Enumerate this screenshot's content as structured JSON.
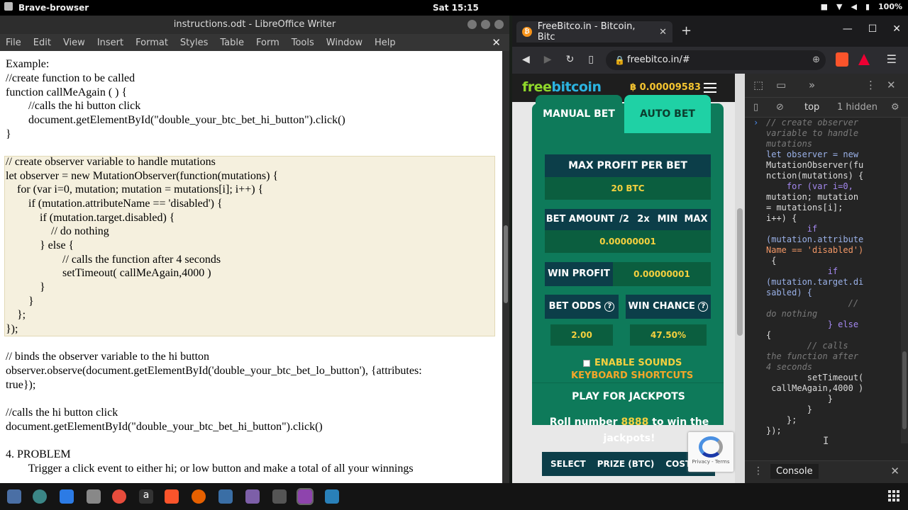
{
  "system_bar": {
    "app_name": "Brave-browser",
    "clock": "Sat 15:15",
    "battery": "100%"
  },
  "libreoffice": {
    "title": "instructions.odt - LibreOffice Writer",
    "menu": [
      "File",
      "Edit",
      "View",
      "Insert",
      "Format",
      "Styles",
      "Table",
      "Form",
      "Tools",
      "Window",
      "Help"
    ],
    "lines": [
      "Example:",
      "//create function to be called",
      "function callMeAgain ( ) {",
      "        //calls the hi button click",
      "        document.getElementById(\"double_your_btc_bet_hi_button\").click()",
      "}",
      "// create observer variable to handle mutations",
      "let observer = new MutationObserver(function(mutations) {",
      "    for (var i=0, mutation; mutation = mutations[i]; i++) {",
      "        if (mutation.attributeName == 'disabled') {",
      "            if (mutation.target.disabled) {",
      "                // do nothing",
      "            } else {",
      "                    // calls the function after 4 seconds",
      "                    setTimeout( callMeAgain,4000 )",
      "            }",
      "        }",
      "    };",
      "});",
      "// binds the observer variable to the hi button",
      "observer.observe(document.getElementById('double_your_btc_bet_lo_button'), {attributes:",
      "true});",
      "//calls the hi button click",
      "document.getElementById(\"double_your_btc_bet_hi_button\").click()",
      "4. PROBLEM",
      "        Trigger a click event to either hi; or low button and make a total of all your winnings"
    ]
  },
  "browser": {
    "tab_title": "FreeBitco.in - Bitcoin, Bitc",
    "url": "freebitco.in/#",
    "site": {
      "logo_part1": "free",
      "logo_part2": "bitcoin",
      "balance": "฿ 0.00009583",
      "tab_manual": "MANUAL BET",
      "tab_auto": "AUTO BET",
      "max_profit_label": "MAX PROFIT PER BET",
      "max_profit_value": "20 BTC",
      "bet_amount_label": "BET AMOUNT",
      "bet_controls": [
        "/2",
        "2x",
        "MIN",
        "MAX"
      ],
      "bet_amount_value": "0.00000001",
      "win_profit_label": "WIN PROFIT",
      "win_profit_value": "0.00000001",
      "bet_odds_label": "BET ODDS",
      "bet_odds_value": "2.00",
      "win_chance_label": "WIN CHANCE",
      "win_chance_value": "47.50%",
      "enable_sounds": "ENABLE SOUNDS",
      "keyboard_shortcuts": "KEYBOARD SHORTCUTS",
      "jackpot_title": "PLAY FOR JACKPOTS",
      "jackpot_pre": "Roll number ",
      "jackpot_number": "8888",
      "jackpot_post": " to win the jackpots!",
      "jackpot_cols": [
        "SELECT",
        "PRIZE (BTC)",
        "COST ("
      ],
      "recaptcha_text": "Privacy - Terms"
    },
    "devtools": {
      "context": "top",
      "hidden": "1 hidden",
      "console_label": "Console",
      "code_lines": [
        "// create observer",
        "variable to handle",
        "mutations",
        "let observer = new",
        "MutationObserver(fu",
        "nction(mutations) {",
        "    for (var i=0,",
        "mutation; mutation",
        "= mutations[i];",
        "i++) {",
        "        if",
        "(mutation.attribute",
        "Name == 'disabled')",
        " {",
        "            if",
        "(mutation.target.di",
        "sabled) {",
        "                //",
        "do nothing",
        "            } else",
        "{",
        "        // calls",
        "the function after",
        "4 seconds",
        "        setTimeout(",
        " callMeAgain,4000 )",
        "            }",
        "        }",
        "    };",
        "});"
      ]
    }
  }
}
